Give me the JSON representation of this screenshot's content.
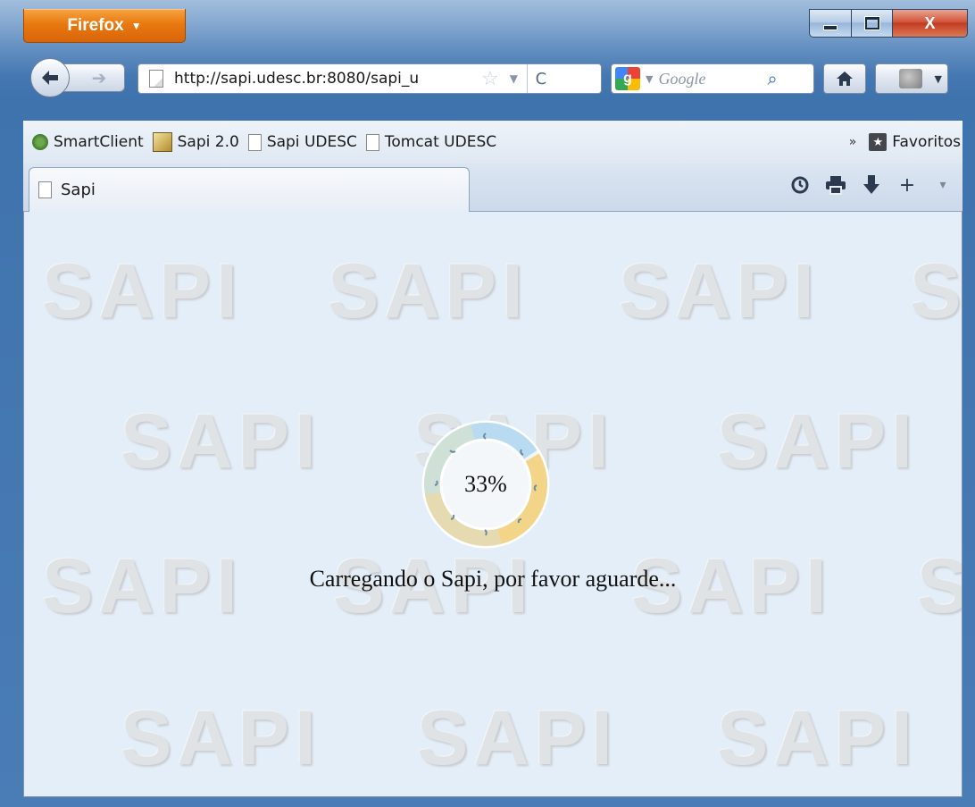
{
  "browser": {
    "menu_button": "Firefox",
    "url": "http://sapi.udesc.br:8080/sapi_u",
    "search_placeholder": "Google",
    "window_controls": {
      "close_glyph": "X"
    }
  },
  "bookmarks": {
    "items": [
      {
        "label": "SmartClient",
        "icon": "smartclient-icon"
      },
      {
        "label": "Sapi 2.0",
        "icon": "sapi2-icon"
      },
      {
        "label": "Sapi UDESC",
        "icon": "page-icon"
      },
      {
        "label": "Tomcat UDESC",
        "icon": "page-icon"
      }
    ],
    "overflow_label": "»",
    "favorites_label": "Favoritos"
  },
  "tabs": [
    {
      "label": "Sapi",
      "active": true
    }
  ],
  "page": {
    "watermark": "SAPI",
    "progress_text": "33%",
    "progress_value": 0.33,
    "loading_message": "Carregando o Sapi, por favor aguarde..."
  },
  "colors": {
    "firefox_orange": "#e8790f",
    "content_bg": "#e4eef9",
    "ring_blue": "#b9dbf2",
    "ring_yellow": "#f3d58a",
    "ring_tan": "#e6dab0",
    "ring_green": "#cfe0d6"
  }
}
